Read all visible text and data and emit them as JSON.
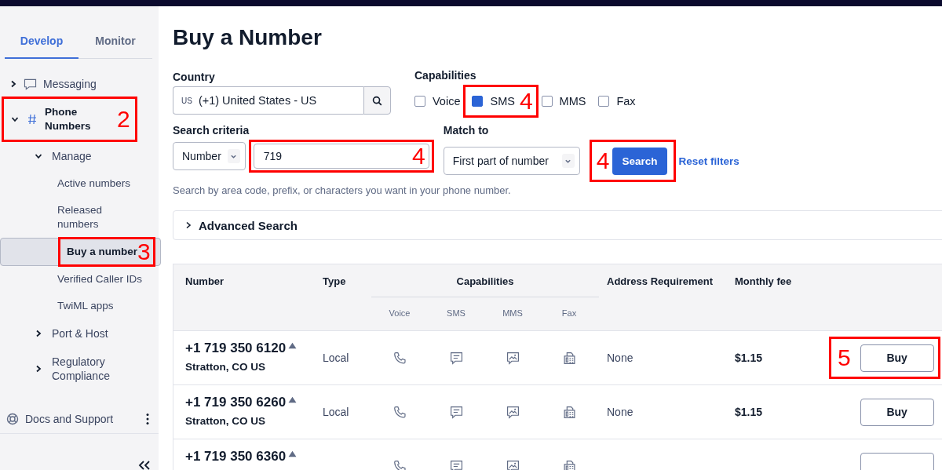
{
  "sidebar": {
    "tabs": [
      {
        "label": "Develop",
        "selected": true
      },
      {
        "label": "Monitor",
        "selected": false
      }
    ],
    "nav": [
      {
        "label": "Messaging",
        "expanded": false
      },
      {
        "label": "Phone Numbers",
        "expanded": true,
        "callout": "2",
        "children": [
          {
            "label": "Manage",
            "expanded": true,
            "children": [
              {
                "label": "Active numbers",
                "selected": false
              },
              {
                "label": "Released numbers",
                "selected": false
              },
              {
                "label": "Buy a number",
                "selected": true,
                "callout": "3"
              },
              {
                "label": "Verified Caller IDs",
                "selected": false
              },
              {
                "label": "TwiML apps",
                "selected": false
              }
            ]
          },
          {
            "label": "Port & Host",
            "expanded": false
          },
          {
            "label": "Regulatory Compliance",
            "expanded": false
          }
        ]
      }
    ],
    "docs": "Docs and Support"
  },
  "main": {
    "title": "Buy a Number",
    "country": {
      "label": "Country",
      "code": "US",
      "value": "(+1) United States - US"
    },
    "capabilities": {
      "label": "Capabilities",
      "options": [
        {
          "label": "Voice",
          "checked": false
        },
        {
          "label": "SMS",
          "checked": true,
          "callout": "4"
        },
        {
          "label": "MMS",
          "checked": false
        },
        {
          "label": "Fax",
          "checked": false
        }
      ]
    },
    "search_criteria": {
      "label": "Search criteria",
      "select": "Number",
      "value": "719",
      "callout": "4"
    },
    "match_to": {
      "label": "Match to",
      "select": "First part of number"
    },
    "search_button": {
      "label": "Search",
      "callout": "4"
    },
    "reset_link": "Reset filters",
    "hint": "Search by area code, prefix, or characters you want in your phone number.",
    "advanced": {
      "label": "Advanced Search",
      "expanded": false
    },
    "table": {
      "columns": [
        "Number",
        "Type",
        "Capabilities",
        "Address Requirement",
        "Monthly fee"
      ],
      "subcolumns": [
        "Voice",
        "SMS",
        "MMS",
        "Fax"
      ],
      "rows": [
        {
          "number": "+1 719 350 6120",
          "location": "Stratton, CO US",
          "type": "Local",
          "caps": [
            true,
            true,
            true,
            true
          ],
          "address": "None",
          "fee": "$1.15",
          "action": "Buy",
          "callout": "5"
        },
        {
          "number": "+1 719 350 6260",
          "location": "Stratton, CO US",
          "type": "Local",
          "caps": [
            true,
            true,
            true,
            true
          ],
          "address": "None",
          "fee": "$1.15",
          "action": "Buy"
        },
        {
          "number": "+1 719 350 6360",
          "caps": [
            true,
            true,
            true,
            true
          ]
        }
      ]
    }
  }
}
